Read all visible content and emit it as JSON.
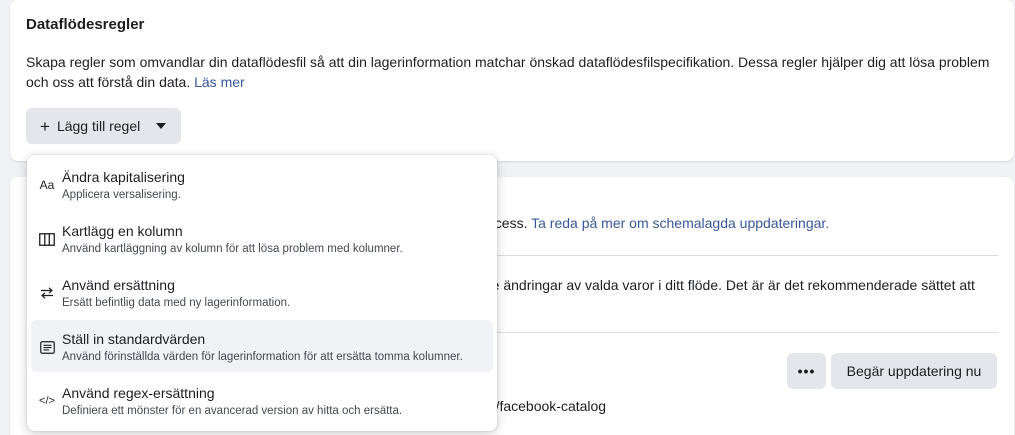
{
  "feed_rules": {
    "title": "Dataflödesregler",
    "description": "Skapa regler som omvandlar din dataflödesfil så att din lagerinformation matchar önskad dataflödesfilspecifikation. Dessa regler hjälper dig att lösa problem och oss att förstå din data.",
    "read_more": "Läs mer",
    "add_rule_label": "Lägg till regel"
  },
  "background": {
    "schedule_text": "ocess.",
    "schedule_link": "Ta reda på mer om schemalagda uppdateringar.",
    "update_text_line1": "re ändringar av valda varor i ditt flöde. Det är är det rekommenderade sättet att",
    "more_label": "•••",
    "request_update_label": "Begär uppdatering nu",
    "url_fragment": "ed/facebook-catalog"
  },
  "menu": {
    "items": [
      {
        "icon": "text-case-icon",
        "glyph": "Aa",
        "label": "Ändra kapitalisering",
        "sub": "Applicera versalisering."
      },
      {
        "icon": "columns-icon",
        "glyph": "",
        "label": "Kartlägg en kolumn",
        "sub": "Använd kartläggning av kolumn för att lösa problem med kolumner."
      },
      {
        "icon": "swap-arrows-icon",
        "glyph": "⇄",
        "label": "Använd ersättning",
        "sub": "Ersätt befintlig data med ny lagerinformation."
      },
      {
        "icon": "form-list-icon",
        "glyph": "",
        "label": "Ställ in standardvärden",
        "sub": "Använd förinställda värden för lagerinformation för att ersätta tomma kolumner."
      },
      {
        "icon": "code-icon",
        "glyph": "</>",
        "label": "Använd regex-ersättning",
        "sub": "Definiera ett mönster för en avancerad version av hitta och ersätta."
      }
    ],
    "selected_index": 3
  }
}
